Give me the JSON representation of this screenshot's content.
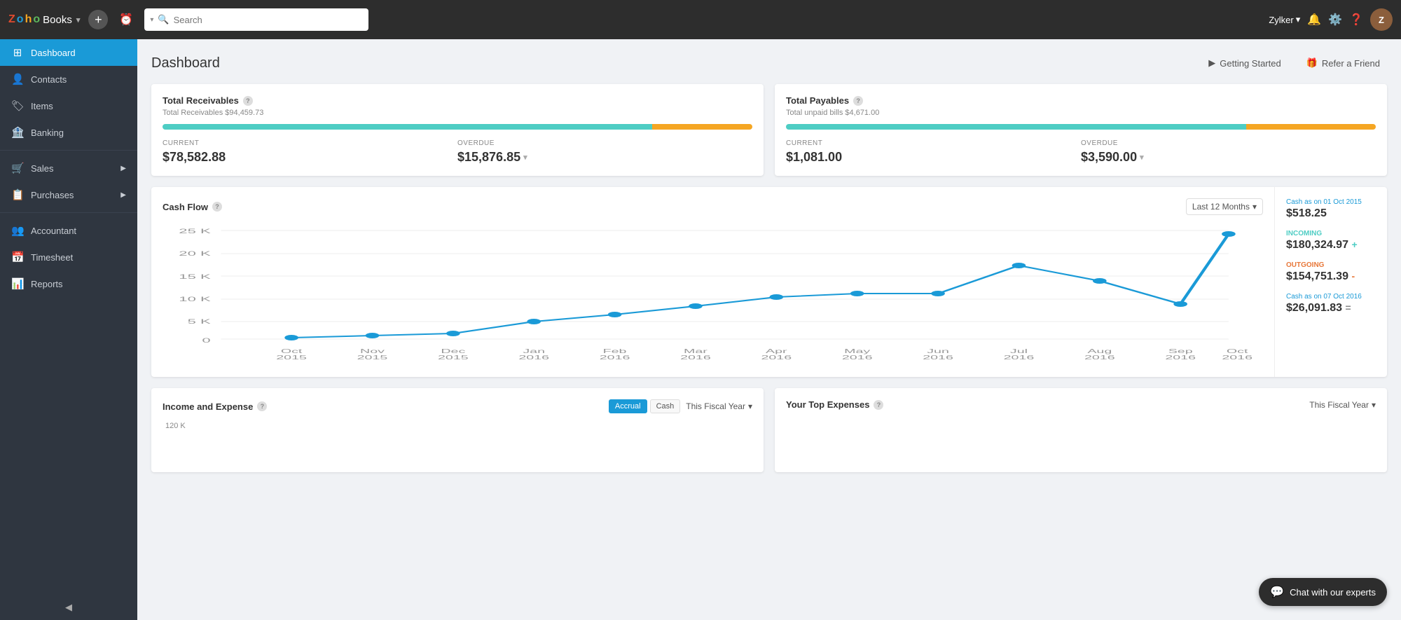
{
  "topbar": {
    "logo_z": "Z",
    "logo_o1": "o",
    "logo_h": "h",
    "logo_o2": "o",
    "logo_books": "Books",
    "logo_caret": "▾",
    "search_placeholder": "Search",
    "user_name": "Zylker",
    "user_caret": "▾"
  },
  "sidebar": {
    "items": [
      {
        "id": "dashboard",
        "label": "Dashboard",
        "icon": "⊞",
        "active": true,
        "has_arrow": false
      },
      {
        "id": "contacts",
        "label": "Contacts",
        "icon": "👤",
        "active": false,
        "has_arrow": false
      },
      {
        "id": "items",
        "label": "Items",
        "icon": "🏷",
        "active": false,
        "has_arrow": false
      },
      {
        "id": "banking",
        "label": "Banking",
        "icon": "🏦",
        "active": false,
        "has_arrow": false
      },
      {
        "id": "sales",
        "label": "Sales",
        "icon": "🛒",
        "active": false,
        "has_arrow": true
      },
      {
        "id": "purchases",
        "label": "Purchases",
        "icon": "📋",
        "active": false,
        "has_arrow": true
      },
      {
        "id": "accountant",
        "label": "Accountant",
        "icon": "👥",
        "active": false,
        "has_arrow": false
      },
      {
        "id": "timesheet",
        "label": "Timesheet",
        "icon": "📅",
        "active": false,
        "has_arrow": false
      },
      {
        "id": "reports",
        "label": "Reports",
        "icon": "📊",
        "active": false,
        "has_arrow": false
      }
    ],
    "collapse_icon": "◀"
  },
  "page": {
    "title": "Dashboard"
  },
  "getting_started": {
    "label": "Getting Started",
    "icon": "▶"
  },
  "refer_friend": {
    "label": "Refer a Friend",
    "icon": "🎁"
  },
  "total_receivables": {
    "title": "Total Receivables",
    "subtitle_label": "Total Receivables",
    "subtitle_value": "$94,459.73",
    "current_label": "CURRENT",
    "current_value": "$78,582.88",
    "overdue_label": "OVERDUE",
    "overdue_value": "$15,876.85",
    "overdue_caret": "▾",
    "bar_teal_pct": 83,
    "bar_yellow_pct": 17
  },
  "total_payables": {
    "title": "Total Payables",
    "subtitle_label": "Total unpaid bills",
    "subtitle_value": "$4,671.00",
    "current_label": "CURRENT",
    "current_value": "$1,081.00",
    "overdue_label": "OVERDUE",
    "overdue_value": "$3,590.00",
    "overdue_caret": "▾",
    "bar_teal_pct": 78,
    "bar_yellow_pct": 22
  },
  "cash_flow": {
    "title": "Cash Flow",
    "period_label": "Last 12 Months",
    "period_caret": "▾",
    "chart_x_labels": [
      "Oct\n2015",
      "Nov\n2015",
      "Dec\n2015",
      "Jan\n2016",
      "Feb\n2016",
      "Mar\n2016",
      "Apr\n2016",
      "May\n2016",
      "Jun\n2016",
      "Jul\n2016",
      "Aug\n2016",
      "Sep\n2016",
      "Oct\n2016"
    ],
    "chart_y_labels": [
      "25 K",
      "20 K",
      "15 K",
      "10 K",
      "5 K",
      "0"
    ],
    "cash_as_on_start_label": "Cash as on 01 Oct 2015",
    "cash_as_on_start_value": "$518.25",
    "incoming_label": "Incoming",
    "incoming_value": "$180,324.97",
    "incoming_sign": "+",
    "outgoing_label": "Outgoing",
    "outgoing_value": "$154,751.39",
    "outgoing_sign": "-",
    "cash_as_on_end_label": "Cash as on 07 Oct 2016",
    "cash_as_on_end_value": "$26,091.83",
    "cash_as_on_end_sign": "="
  },
  "income_expense": {
    "title": "Income and Expense",
    "period_label": "This Fiscal Year",
    "period_caret": "▾",
    "toggle_accrual": "Accrual",
    "toggle_cash": "Cash",
    "y_label": "120 K"
  },
  "top_expenses": {
    "title": "Your Top Expenses",
    "period_label": "This Fiscal Year",
    "period_caret": "▾"
  },
  "chat_widget": {
    "label": "Chat with our experts",
    "icon": "💬"
  }
}
